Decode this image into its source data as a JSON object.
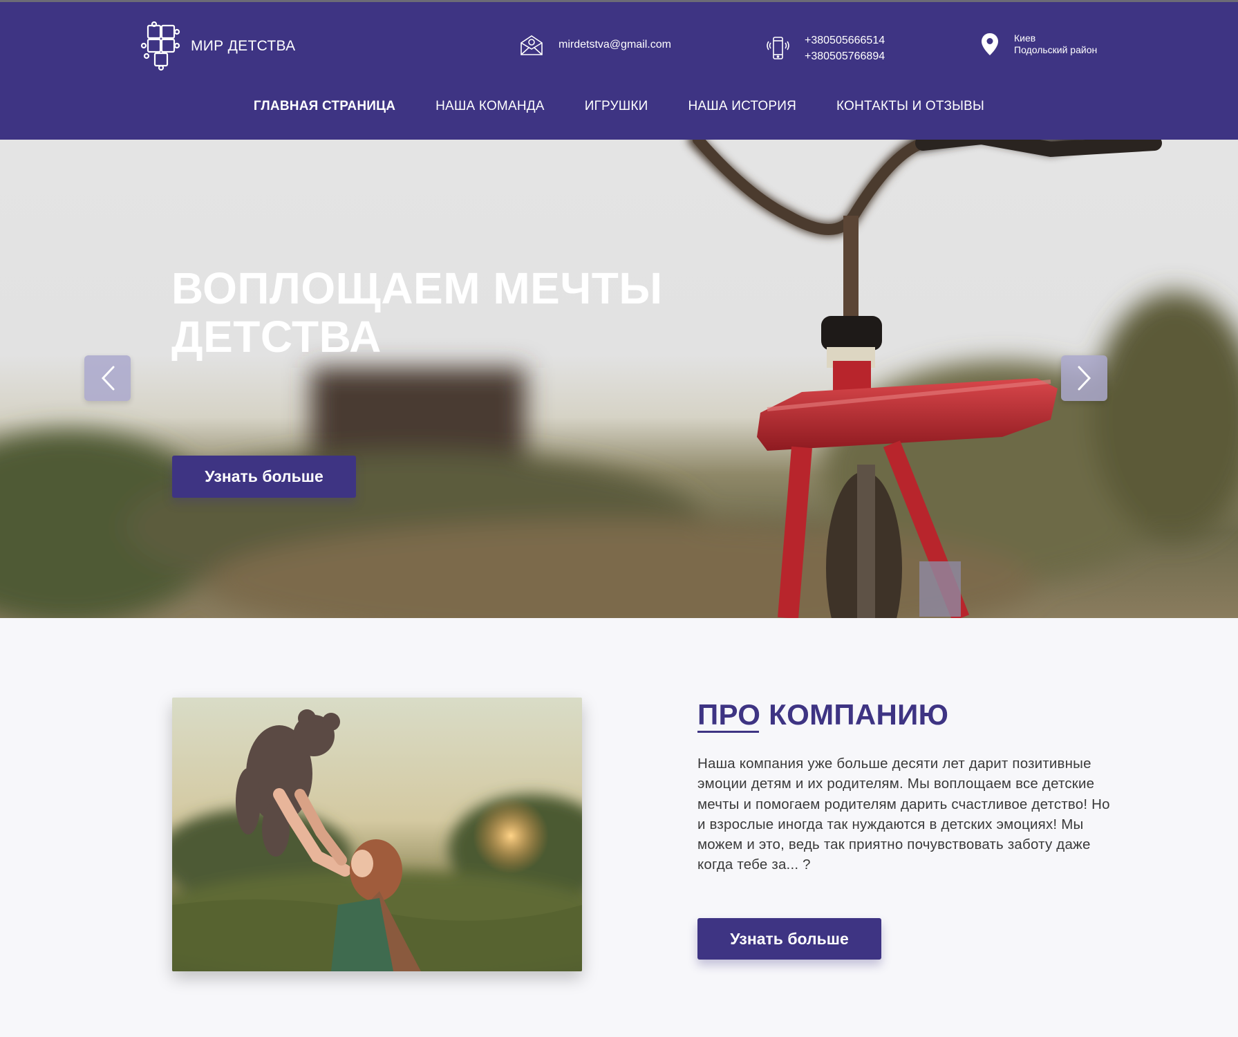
{
  "brand": {
    "name": "МИР ДЕТСТВА",
    "logo_icon": "puzzle-icon"
  },
  "contacts": {
    "email": "mirdetstva@gmail.com",
    "phones": [
      "+380505666514",
      "+380505766894"
    ],
    "address": [
      "Киев",
      "Подольский район"
    ]
  },
  "nav": {
    "items": [
      {
        "label": "ГЛАВНАЯ СТРАНИЦА",
        "active": true
      },
      {
        "label": "НАША КОМАНДА"
      },
      {
        "label": "ИГРУШКИ"
      },
      {
        "label": "НАША ИСТОРИЯ"
      },
      {
        "label": "КОНТАКТЫ И ОТЗЫВЫ"
      }
    ]
  },
  "hero": {
    "title_line1": "ВОПЛОЩАЕМ МЕЧТЫ",
    "title_line2": "ДЕТСТВА",
    "button": "Узнать больше"
  },
  "about": {
    "title": "ПРО КОМПАНИЮ",
    "text": "Наша компания уже больше десяти лет дарит позитивные эмоции детям и их родителям. Мы воплощаем все детские мечты и помогаем родителям дарить счастливое детство! Но и взрослые иногда так нуждаются в детских эмоциях! Мы можем и это, ведь так приятно почувствовать заботу даже когда тебе за... ?",
    "button": "Узнать больше"
  },
  "colors": {
    "brand": "#3e3483",
    "background": "#f7f7fa",
    "bike_red": "#b8252c"
  }
}
